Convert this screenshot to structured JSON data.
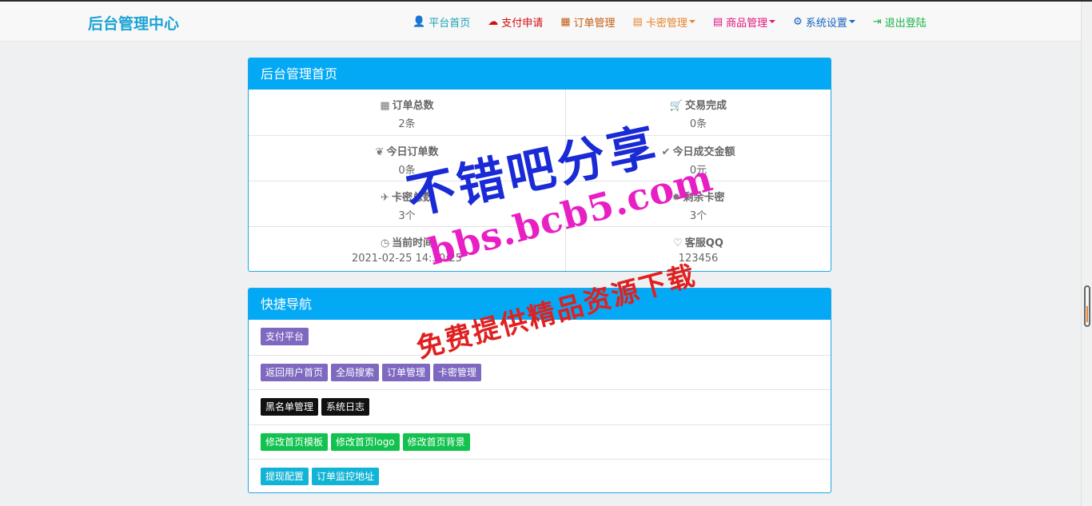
{
  "brand": "后台管理中心",
  "nav": [
    {
      "label": "平台首页",
      "icon": "user-icon",
      "glyph": "👤",
      "color": "#17a2b8",
      "caret": false
    },
    {
      "label": "支付申请",
      "icon": "cloud-icon",
      "glyph": "☁",
      "color": "#d60b0b",
      "caret": false
    },
    {
      "label": "订单管理",
      "icon": "calendar-icon",
      "glyph": "▦",
      "color": "#c45a0f",
      "caret": false
    },
    {
      "label": "卡密管理",
      "icon": "list-icon",
      "glyph": "▤",
      "color": "#e8822b",
      "caret": true
    },
    {
      "label": "商品管理",
      "icon": "list-alt-icon",
      "glyph": "▤",
      "color": "#e3157f",
      "caret": true
    },
    {
      "label": "系统设置",
      "icon": "gear-icon",
      "glyph": "⚙",
      "color": "#1565c0",
      "caret": true
    },
    {
      "label": "退出登陆",
      "icon": "logout-icon",
      "glyph": "⇥",
      "color": "#19b34a",
      "caret": false
    }
  ],
  "dashboard": {
    "title": "后台管理首页",
    "stats": [
      {
        "left": {
          "label": "订单总数",
          "icon": "grid-icon",
          "glyph": "▦",
          "value": "2条"
        },
        "right": {
          "label": "交易完成",
          "icon": "cart-icon",
          "glyph": "🛒",
          "value": "0条"
        }
      },
      {
        "left": {
          "label": "今日订单数",
          "icon": "leaf-icon",
          "glyph": "❦",
          "value": "0条"
        },
        "right": {
          "label": "今日成交金额",
          "icon": "check-icon",
          "glyph": "✔",
          "value": "0元"
        }
      },
      {
        "left": {
          "label": "卡密总数",
          "icon": "plane-icon",
          "glyph": "✈",
          "value": "3个"
        },
        "right": {
          "label": "剩余卡密",
          "icon": "asterisk-icon",
          "glyph": "✹",
          "value": "3个"
        }
      },
      {
        "left": {
          "label": "当前时间",
          "icon": "clock-icon",
          "glyph": "◷",
          "value": "2021-02-25 14:30:25"
        },
        "right": {
          "label": "客服QQ",
          "icon": "heart-icon",
          "glyph": "♡",
          "value": "123456"
        }
      }
    ]
  },
  "quicknav": {
    "title": "快捷导航",
    "rows": [
      [
        {
          "label": "支付平台",
          "color": "#7e68c0"
        }
      ],
      [
        {
          "label": "返回用户首页",
          "color": "#7e68c0"
        },
        {
          "label": "全局搜索",
          "color": "#7e68c0"
        },
        {
          "label": "订单管理",
          "color": "#7e68c0"
        },
        {
          "label": "卡密管理",
          "color": "#7e68c0"
        }
      ],
      [
        {
          "label": "黑名单管理",
          "color": "#111111"
        },
        {
          "label": "系统日志",
          "color": "#111111"
        }
      ],
      [
        {
          "label": "修改首页模板",
          "color": "#12c24e"
        },
        {
          "label": "修改首页logo",
          "color": "#12c24e"
        },
        {
          "label": "修改首页背景",
          "color": "#12c24e"
        }
      ],
      [
        {
          "label": "提现配置",
          "color": "#12b4d6"
        },
        {
          "label": "订单监控地址",
          "color": "#12b4d6"
        }
      ]
    ]
  },
  "watermark": {
    "line1": "不错吧分享",
    "line2": "bbs.bcb5.com",
    "line3": "免费提供精品资源下载"
  }
}
